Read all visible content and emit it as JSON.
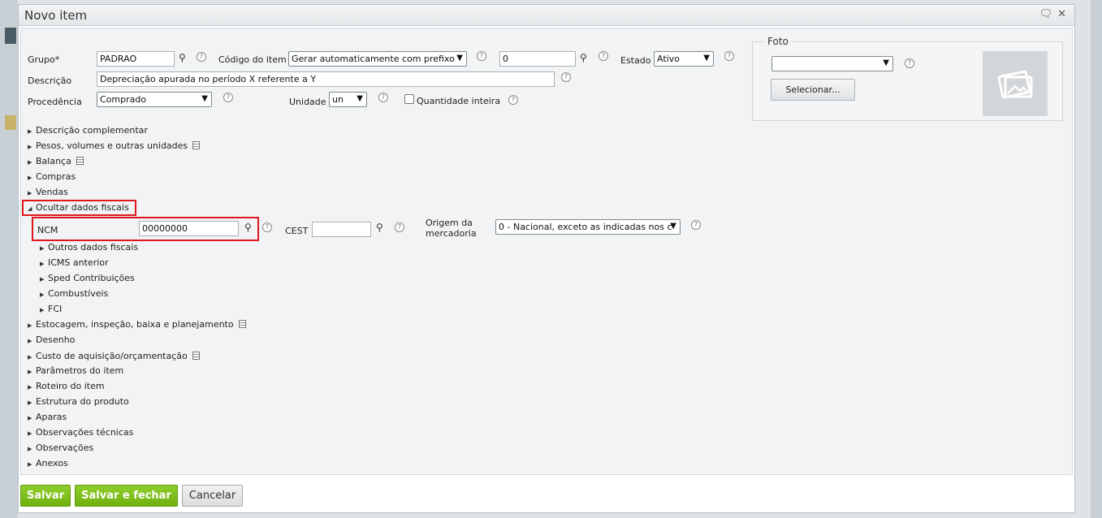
{
  "dialog": {
    "title": "Novo item"
  },
  "form": {
    "grupo_label": "Grupo*",
    "grupo_value": "PADRAO",
    "codigo_label": "Código do item",
    "codigo_select": "Gerar automaticamente com prefixo",
    "codigo_value": "0",
    "estado_label": "Estado",
    "estado_select": "Ativo",
    "descricao_label": "Descrição",
    "descricao_value": "Depreciação apurada no período X referente a Y",
    "procedencia_label": "Procedência",
    "procedencia_select": "Comprado",
    "unidade_label": "Unidade",
    "unidade_select": "un",
    "quantidade_label": "Quantidade inteira"
  },
  "foto": {
    "legend": "Foto",
    "select_value": "",
    "button": "Selecionar..."
  },
  "sections": [
    "Descrição complementar",
    "Pesos, volumes e outras unidades",
    "Balança",
    "Compras",
    "Vendas",
    "Ocultar dados fiscais"
  ],
  "fiscal": {
    "ncm_label": "NCM",
    "ncm_value": "00000000",
    "cest_label": "CEST",
    "cest_value": "",
    "origem_label_1": "Origem da",
    "origem_label_2": "mercadoria",
    "origem_select": "0 - Nacional, exceto as indicadas nos c",
    "subsections": [
      "Outros dados fiscais",
      "ICMS anterior",
      "Sped Contribuições",
      "Combustíveis",
      "FCI"
    ]
  },
  "sections_after": [
    "Estocagem, inspeção, baixa e planejamento",
    "Desenho",
    "Custo de aquisição/orçamentação",
    "Parâmetros do item",
    "Roteiro do item",
    "Estrutura do produto",
    "Aparas",
    "Observações técnicas",
    "Observações",
    "Anexos"
  ],
  "footer": {
    "save": "Salvar",
    "save_close": "Salvar e fechar",
    "cancel": "Cancelar"
  }
}
